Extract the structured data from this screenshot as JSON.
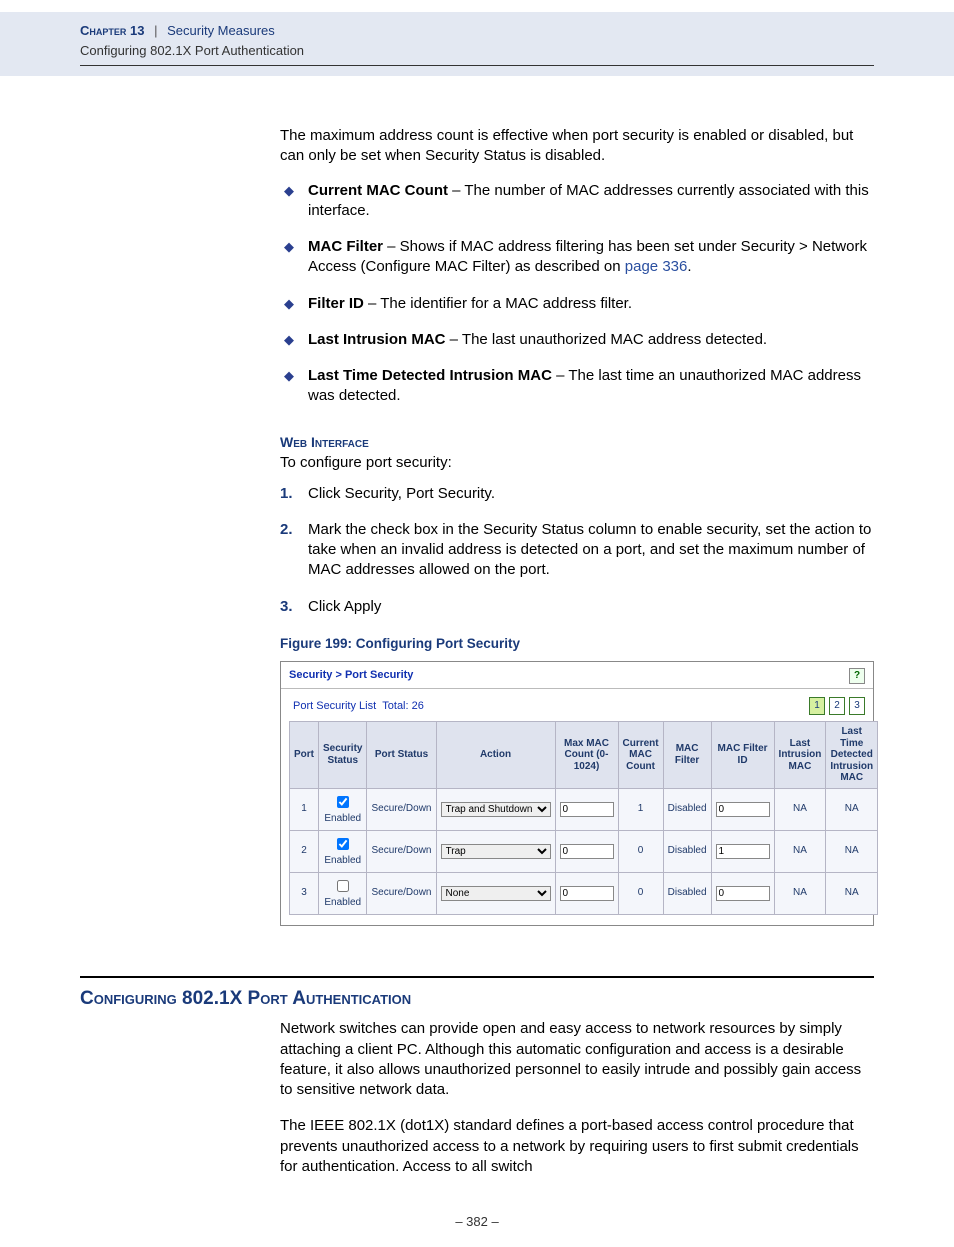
{
  "header": {
    "chapter_label": "Chapter 13",
    "separator": "|",
    "chapter_title": "Security Measures",
    "subtitle": "Configuring 802.1X Port Authentication"
  },
  "intro": "The maximum address count is effective when port security is enabled or disabled, but can only be set when Security Status is disabled.",
  "bullets": {
    "b1_label": "Current MAC Count",
    "b1_text": " – The number of MAC addresses currently associated with this interface.",
    "b2_label": "MAC Filter",
    "b2_text_a": " – Shows if MAC address filtering has been set under Security > Network Access (Configure MAC Filter) as described on ",
    "b2_link": "page 336",
    "b2_text_b": ".",
    "b3_label": "Filter ID",
    "b3_text": " – The identifier for a MAC address filter.",
    "b4_label": "Last Intrusion MAC",
    "b4_text": " – The last unauthorized MAC address detected.",
    "b5_label": "Last Time Detected Intrusion MAC",
    "b5_text": " – The last time an unauthorized MAC address was detected."
  },
  "web_heading": "Web Interface",
  "web_intro": "To configure port security:",
  "steps": {
    "s1": "Click Security, Port Security.",
    "s2": "Mark the check box in the Security Status column to enable security, set the action to take when an invalid address is detected on a port, and set the maximum number of MAC addresses allowed on the port.",
    "s3": "Click Apply"
  },
  "figure_caption": "Figure 199:  Configuring Port Security",
  "screenshot": {
    "breadcrumb": "Security > Port Security",
    "help": "?",
    "list_label": "Port Security List",
    "total_label": "Total: 26",
    "pagers": [
      "1",
      "2",
      "3"
    ],
    "cols": {
      "c1": "Port",
      "c2": "Security Status",
      "c3": "Port Status",
      "c4": "Action",
      "c5": "Max MAC Count (0-1024)",
      "c6": "Current MAC Count",
      "c7": "MAC Filter",
      "c8": "MAC Filter ID",
      "c9": "Last Intrusion MAC",
      "c10": "Last Time Detected Intrusion MAC"
    },
    "rows": [
      {
        "port": "1",
        "sec_checked": true,
        "sec_label": "Enabled",
        "status": "Secure/Down",
        "action": "Trap and Shutdown",
        "max": "0",
        "cur": "1",
        "filter": "Disabled",
        "fid": "0",
        "last": "NA",
        "lasttime": "NA"
      },
      {
        "port": "2",
        "sec_checked": true,
        "sec_label": "Enabled",
        "status": "Secure/Down",
        "action": "Trap",
        "max": "0",
        "cur": "0",
        "filter": "Disabled",
        "fid": "1",
        "last": "NA",
        "lasttime": "NA"
      },
      {
        "port": "3",
        "sec_checked": false,
        "sec_label": "Enabled",
        "status": "Secure/Down",
        "action": "None",
        "max": "0",
        "cur": "0",
        "filter": "Disabled",
        "fid": "0",
        "last": "NA",
        "lasttime": "NA"
      }
    ]
  },
  "section_heading": "Configuring 802.1X Port Authentication",
  "section_p1": "Network switches can provide open and easy access to network resources by simply attaching a client PC. Although this automatic configuration and access is a desirable feature, it also allows unauthorized personnel to easily intrude and possibly gain access to sensitive network data.",
  "section_p2": "The IEEE 802.1X (dot1X) standard defines a port-based access control procedure that prevents unauthorized access to a network by requiring users to first submit credentials for authentication. Access to all switch",
  "page_number": "–  382  –"
}
